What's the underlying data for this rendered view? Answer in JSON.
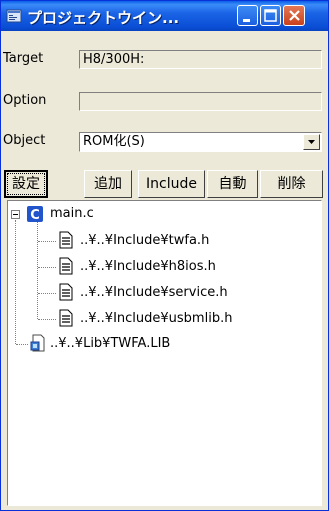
{
  "window": {
    "title": "プロジェクトウイン..."
  },
  "fields": {
    "target": {
      "label": "Target",
      "value": "H8/300H:"
    },
    "option": {
      "label": "Option",
      "value": ""
    },
    "object": {
      "label": "Object",
      "value": "ROM化(S)"
    }
  },
  "buttons": [
    {
      "label": "設定"
    },
    {
      "label": "追加"
    },
    {
      "label": "Include"
    },
    {
      "label": "自動"
    },
    {
      "label": "削除"
    }
  ],
  "tree": {
    "root": {
      "label": "main.c",
      "icon": "c-source-icon"
    },
    "children": [
      {
        "label": "..¥..¥Include¥twfa.h",
        "icon": "header-file-icon"
      },
      {
        "label": "..¥..¥Include¥h8ios.h",
        "icon": "header-file-icon"
      },
      {
        "label": "..¥..¥Include¥service.h",
        "icon": "header-file-icon"
      },
      {
        "label": "..¥..¥Include¥usbmlib.h",
        "icon": "header-file-icon"
      }
    ],
    "library": {
      "label": "..¥..¥Lib¥TWFA.LIB",
      "icon": "library-file-icon"
    }
  },
  "colors": {
    "titlebar": "#0a4fd6",
    "close": "#c8421b",
    "panel": "#ece9d8",
    "select_icon": "#2255cc"
  }
}
